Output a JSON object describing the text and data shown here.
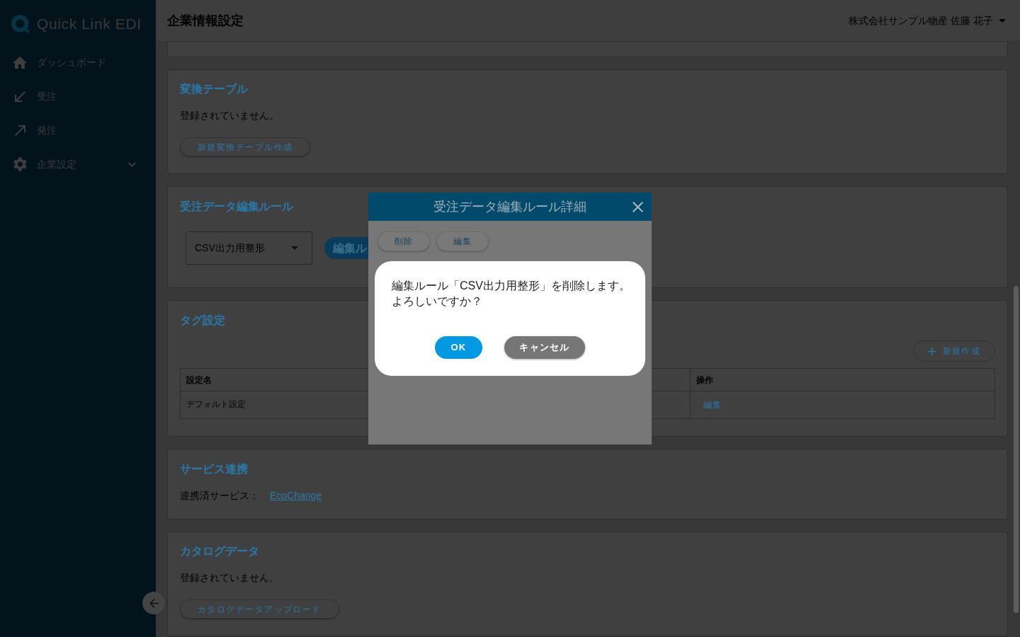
{
  "sidebar": {
    "logo": "Quick Link EDI",
    "items": [
      {
        "label": "ダッシュボード",
        "kind": "link"
      },
      {
        "label": "受注",
        "kind": "link"
      },
      {
        "label": "発注",
        "kind": "link"
      },
      {
        "label": "企業設定",
        "kind": "group",
        "expanded": false
      }
    ]
  },
  "header": {
    "title": "企業情報設定",
    "user": "株式会社サンプル物産 佐藤 花子"
  },
  "sections": [
    {
      "kind": "empty_list",
      "title": "変換テーブル",
      "empty_text": "登録されていません。",
      "button": "新規変換テーブル作成"
    },
    {
      "kind": "select",
      "title": "受注データ編集ルール",
      "select_value": "CSV出力用整形",
      "button": "編集ル"
    },
    {
      "kind": "table",
      "title": "タグ設定",
      "button": "新規作成",
      "table": {
        "columns": [
          "設定名",
          "操作"
        ],
        "rows": [
          [
            "デフォルト設定",
            "編集"
          ]
        ]
      }
    },
    {
      "kind": "service",
      "title": "サービス連携",
      "label": "連携済サービス：",
      "link": "EcoChange"
    },
    {
      "kind": "empty_list",
      "title": "カタログデータ",
      "empty_text": "登録されていません。",
      "button": "カタログデータアップロード"
    }
  ],
  "detail_modal": {
    "title": "受注データ編集ルール詳細",
    "buttons": [
      "削除",
      "編集"
    ]
  },
  "confirm_dialog": {
    "message_lines": [
      "編集ルール「CSV出力用整形」を削除します。",
      "よろしいですか？"
    ],
    "buttons": [
      {
        "label": "OK",
        "kind": "primary"
      },
      {
        "label": "キャンセル",
        "kind": "secondary"
      }
    ]
  }
}
